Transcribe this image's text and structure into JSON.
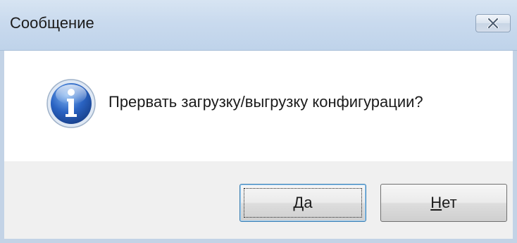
{
  "window": {
    "title": "Сообщение",
    "close_icon": "close-x-icon"
  },
  "message": {
    "icon": "info-icon",
    "text": "Прервать загрузку/выгрузку конфигурации?"
  },
  "buttons": {
    "yes": {
      "mnemonic": "Д",
      "rest": "а"
    },
    "no": {
      "mnemonic": "Н",
      "rest": "ет"
    }
  },
  "colors": {
    "title_bar": "#c9daee",
    "button_area": "#f0f0f0",
    "default_button_border": "#3c7fb1",
    "info_icon": "#2a5fb0"
  }
}
